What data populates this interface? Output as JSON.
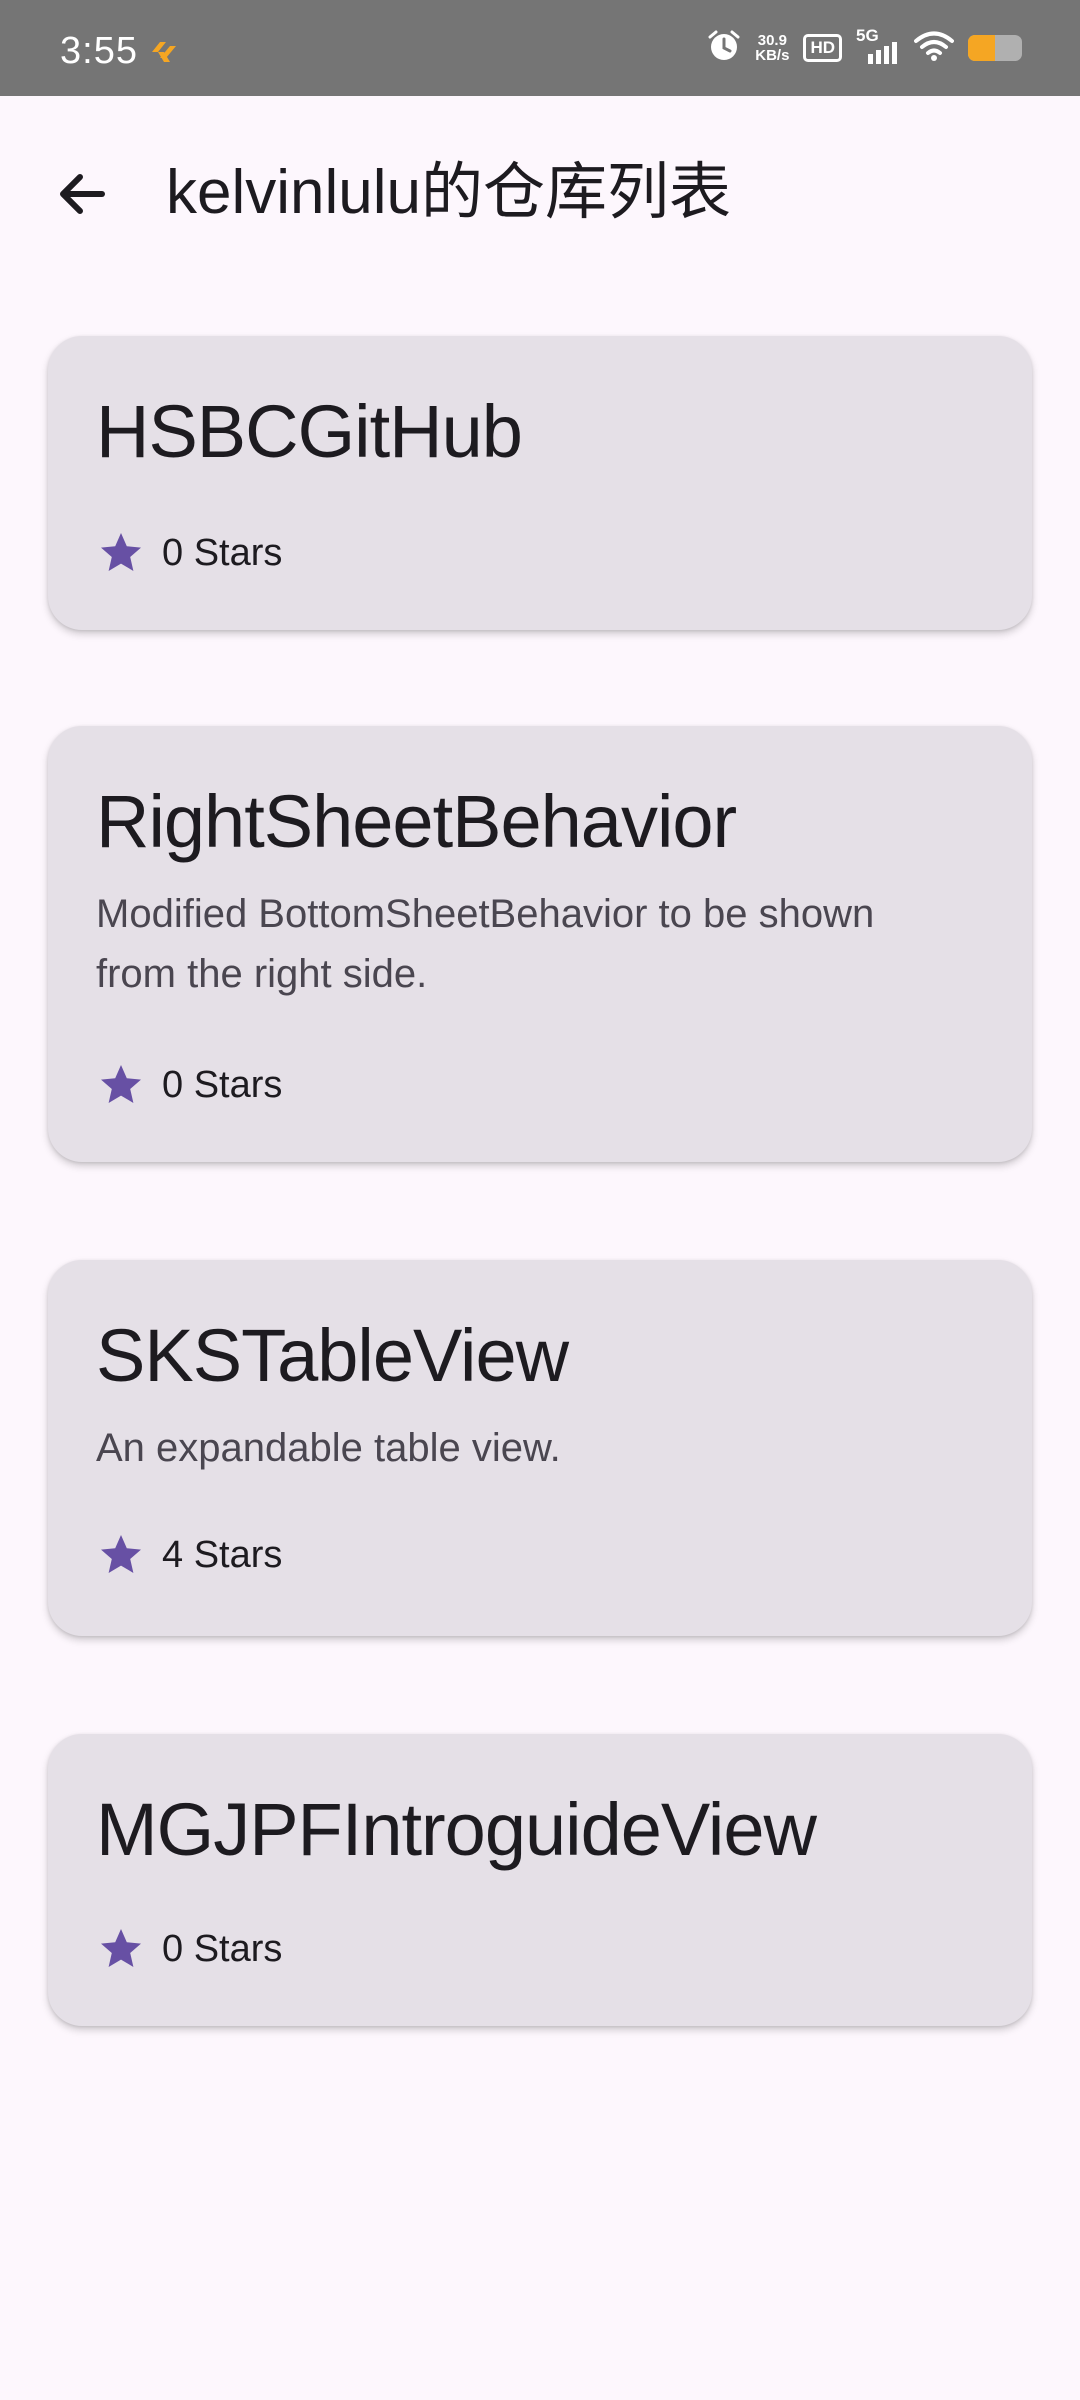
{
  "status_bar": {
    "time": "3:55",
    "net_speed_value": "30.9",
    "net_speed_unit": "KB/s",
    "hd_label": "HD",
    "network_label": "5G",
    "icons": [
      "alarm-icon",
      "hd-icon",
      "5g-signal-icon",
      "wifi-icon",
      "battery-icon"
    ],
    "battery_color": "#f5a623"
  },
  "app_bar": {
    "title": "kelvinlulu的仓库列表",
    "back_icon": "arrow-left-icon"
  },
  "accent_color": "#6750a4",
  "repos": [
    {
      "name": "HSBCGitHub",
      "description": "",
      "stars_label": "0 Stars"
    },
    {
      "name": "RightSheetBehavior",
      "description": "Modified BottomSheetBehavior to be shown from the right side.",
      "stars_label": "0 Stars"
    },
    {
      "name": "SKSTableView",
      "description": "An expandable table view.",
      "stars_label": "4 Stars"
    },
    {
      "name": "MGJPFIntroguideView",
      "description": "",
      "stars_label": "0 Stars"
    }
  ]
}
